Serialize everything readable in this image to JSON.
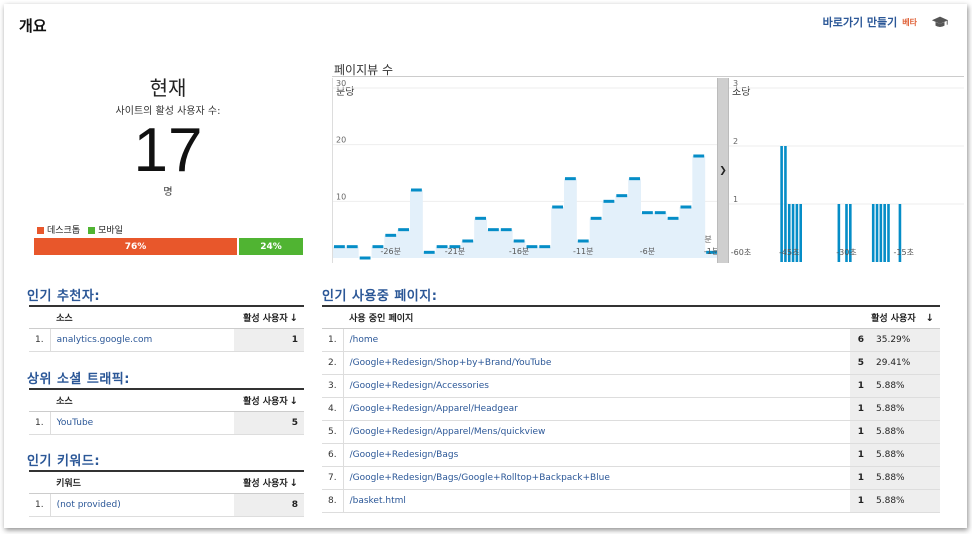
{
  "header": {
    "title": "개요",
    "shortcut_label": "바로가기 만들기",
    "beta_label": "베타",
    "cap_icon": "graduation-cap-icon"
  },
  "realtime": {
    "label": "현재",
    "sublabel": "사이트의 활성 사용자 수:",
    "count": "17",
    "unit": "명",
    "legend": [
      {
        "name": "데스크톱",
        "color": "#e8572b"
      },
      {
        "name": "모바일",
        "color": "#50b432"
      }
    ],
    "devices": [
      {
        "label": "76%",
        "share": 76,
        "color": "#e8572b"
      },
      {
        "label": "24%",
        "share": 24,
        "color": "#50b432"
      }
    ]
  },
  "pageviews": {
    "title": "페이지뷰 수",
    "per_minute": {
      "label": "분당",
      "y_ticks": [
        "30",
        "20",
        "10"
      ],
      "x_ticks": [
        "-26분",
        "-21분",
        "-16분",
        "-11분",
        "-6분",
        "-1분"
      ],
      "end_label": "분"
    },
    "per_second": {
      "label": "초당",
      "y_ticks": [
        "3",
        "2",
        "1"
      ],
      "x_ticks": [
        "-60초",
        "-45초",
        "-30초",
        "-15초"
      ]
    }
  },
  "chart_data": [
    {
      "type": "area",
      "title": "분당",
      "x": [
        -30,
        -29,
        -28,
        -27,
        -26,
        -25,
        -24,
        -23,
        -22,
        -21,
        -20,
        -19,
        -18,
        -17,
        -16,
        -15,
        -14,
        -13,
        -12,
        -11,
        -10,
        -9,
        -8,
        -7,
        -6,
        -5,
        -4,
        -3,
        -2,
        -1
      ],
      "values": [
        2,
        2,
        0,
        2,
        4,
        5,
        12,
        1,
        2,
        2,
        3,
        7,
        5,
        5,
        3,
        2,
        2,
        9,
        14,
        3,
        7,
        10,
        11,
        14,
        8,
        8,
        7,
        9,
        18,
        1
      ],
      "ylim": [
        0,
        30
      ],
      "y_ticks": [
        10,
        20,
        30
      ]
    },
    {
      "type": "bar",
      "title": "초당",
      "x": [
        -47,
        -46,
        -45,
        -44,
        -43,
        -42,
        -32,
        -30,
        -29,
        -23,
        -22,
        -21,
        -20,
        -19,
        -16
      ],
      "values": [
        2,
        2,
        1,
        1,
        1,
        1,
        1,
        1,
        1,
        1,
        1,
        1,
        1,
        1,
        1
      ],
      "ylim": [
        0,
        3
      ],
      "y_ticks": [
        1,
        2,
        3
      ],
      "xlim": [
        -60,
        0
      ]
    }
  ],
  "referrals": {
    "title": "인기 추천자:",
    "col_source": "소스",
    "col_users": "활성 사용자",
    "rows": [
      {
        "idx": "1.",
        "source": "analytics.google.com",
        "users": "1"
      }
    ]
  },
  "social": {
    "title": "상위 소셜 트래픽:",
    "col_source": "소스",
    "col_users": "활성 사용자",
    "rows": [
      {
        "idx": "1.",
        "source": "YouTube",
        "users": "5"
      }
    ]
  },
  "keywords": {
    "title": "인기 키워드:",
    "col_keyword": "키워드",
    "col_users": "활성 사용자",
    "rows": [
      {
        "idx": "1.",
        "keyword": "(not provided)",
        "users": "8"
      }
    ]
  },
  "pages": {
    "title": "인기 사용중 페이지:",
    "col_page": "사용 중인 페이지",
    "col_users": "활성 사용자",
    "rows": [
      {
        "idx": "1.",
        "page": "/home",
        "users": "6",
        "pct": "35.29%"
      },
      {
        "idx": "2.",
        "page": "/Google+Redesign/Shop+by+Brand/YouTube",
        "users": "5",
        "pct": "29.41%"
      },
      {
        "idx": "3.",
        "page": "/Google+Redesign/Accessories",
        "users": "1",
        "pct": "5.88%"
      },
      {
        "idx": "4.",
        "page": "/Google+Redesign/Apparel/Headgear",
        "users": "1",
        "pct": "5.88%"
      },
      {
        "idx": "5.",
        "page": "/Google+Redesign/Apparel/Mens/quickview",
        "users": "1",
        "pct": "5.88%"
      },
      {
        "idx": "6.",
        "page": "/Google+Redesign/Bags",
        "users": "1",
        "pct": "5.88%"
      },
      {
        "idx": "7.",
        "page": "/Google+Redesign/Bags/Google+Rolltop+Backpack+Blue",
        "users": "1",
        "pct": "5.88%"
      },
      {
        "idx": "8.",
        "page": "/basket.html",
        "users": "1",
        "pct": "5.88%"
      }
    ]
  }
}
